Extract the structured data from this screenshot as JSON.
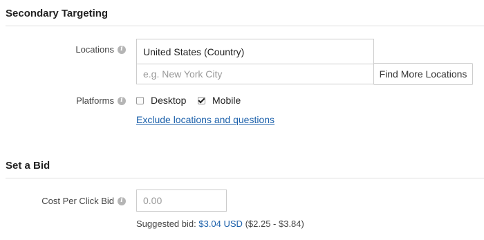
{
  "secondary_targeting": {
    "title": "Secondary Targeting",
    "locations_label": "Locations",
    "location_value": "United States (Country)",
    "location_placeholder": "e.g. New York City",
    "find_more_button": "Find More Locations",
    "platforms_label": "Platforms",
    "platforms": [
      {
        "label": "Desktop",
        "checked": false
      },
      {
        "label": "Mobile",
        "checked": true
      }
    ],
    "exclude_link": "Exclude locations and questions"
  },
  "set_a_bid": {
    "title": "Set a Bid",
    "cpc_label": "Cost Per Click Bid",
    "cpc_placeholder": "0.00",
    "suggested_prefix": "Suggested bid: ",
    "suggested_amount": "$3.04 USD",
    "suggested_range": " ($2.25 - $3.84)"
  },
  "colors": {
    "link": "#1a5faa",
    "divider": "#dddddd",
    "info_icon": "#b5b5b5"
  },
  "icons": [
    "info-icon",
    "checkbox-unchecked",
    "checkbox-checked"
  ]
}
